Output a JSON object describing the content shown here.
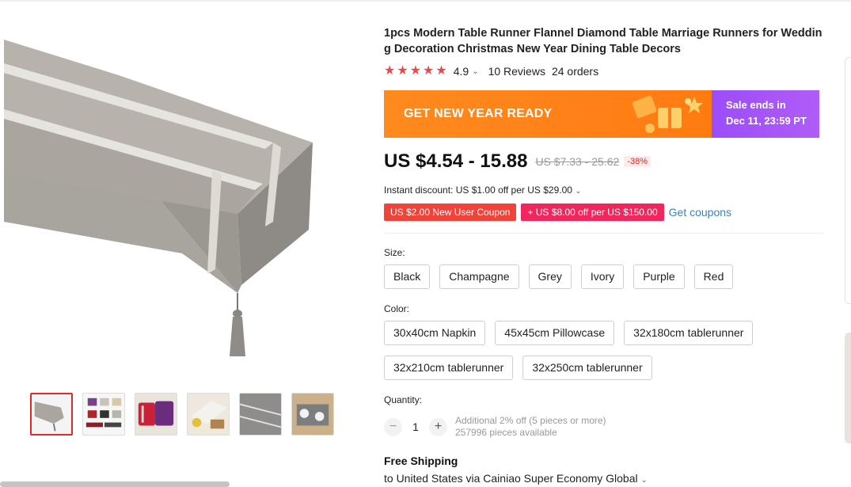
{
  "product": {
    "title": "1pcs Modern Table Runner Flannel Diamond Table Marriage Runners for Wedding Decoration Christmas New Year Dining Table Decors",
    "rating": "4.9",
    "reviews": "10 Reviews",
    "orders": "24 orders"
  },
  "banner": {
    "headline": "GET NEW YEAR READY",
    "sale_line1": "Sale ends in",
    "sale_line2": "Dec 11, 23:59 PT"
  },
  "price": {
    "current": "US $4.54 - 15.88",
    "original": "US $7.33 - 25.62",
    "discount": "-38%"
  },
  "instant_discount": "Instant discount: US $1.00 off per US $29.00",
  "coupons": {
    "new_user": "US $2.00 New User Coupon",
    "store": "+ US $8.00 off per US $150.00",
    "get_link": "Get coupons"
  },
  "size": {
    "label": "Size:",
    "options": [
      "Black",
      "Champagne",
      "Grey",
      "Ivory",
      "Purple",
      "Red"
    ]
  },
  "color": {
    "label": "Color:",
    "options": [
      "30x40cm Napkin",
      "45x45cm Pillowcase",
      "32x180cm tablerunner",
      "32x210cm tablerunner",
      "32x250cm tablerunner"
    ]
  },
  "quantity": {
    "label": "Quantity:",
    "value": "1",
    "minus": "−",
    "plus": "+",
    "note1": "Additional 2% off (5 pieces or more)",
    "note2": "257996 pieces available"
  },
  "shipping": {
    "title": "Free Shipping",
    "detail": "to United States via Cainiao Super Economy Global"
  },
  "icons": {
    "star": "★",
    "chevron": "⌄"
  },
  "colors": {
    "accent_red": "#e0292b",
    "banner_orange": "#ff8a1e",
    "banner_purple": "#9b4dfa",
    "link_blue": "#3a82b7"
  }
}
